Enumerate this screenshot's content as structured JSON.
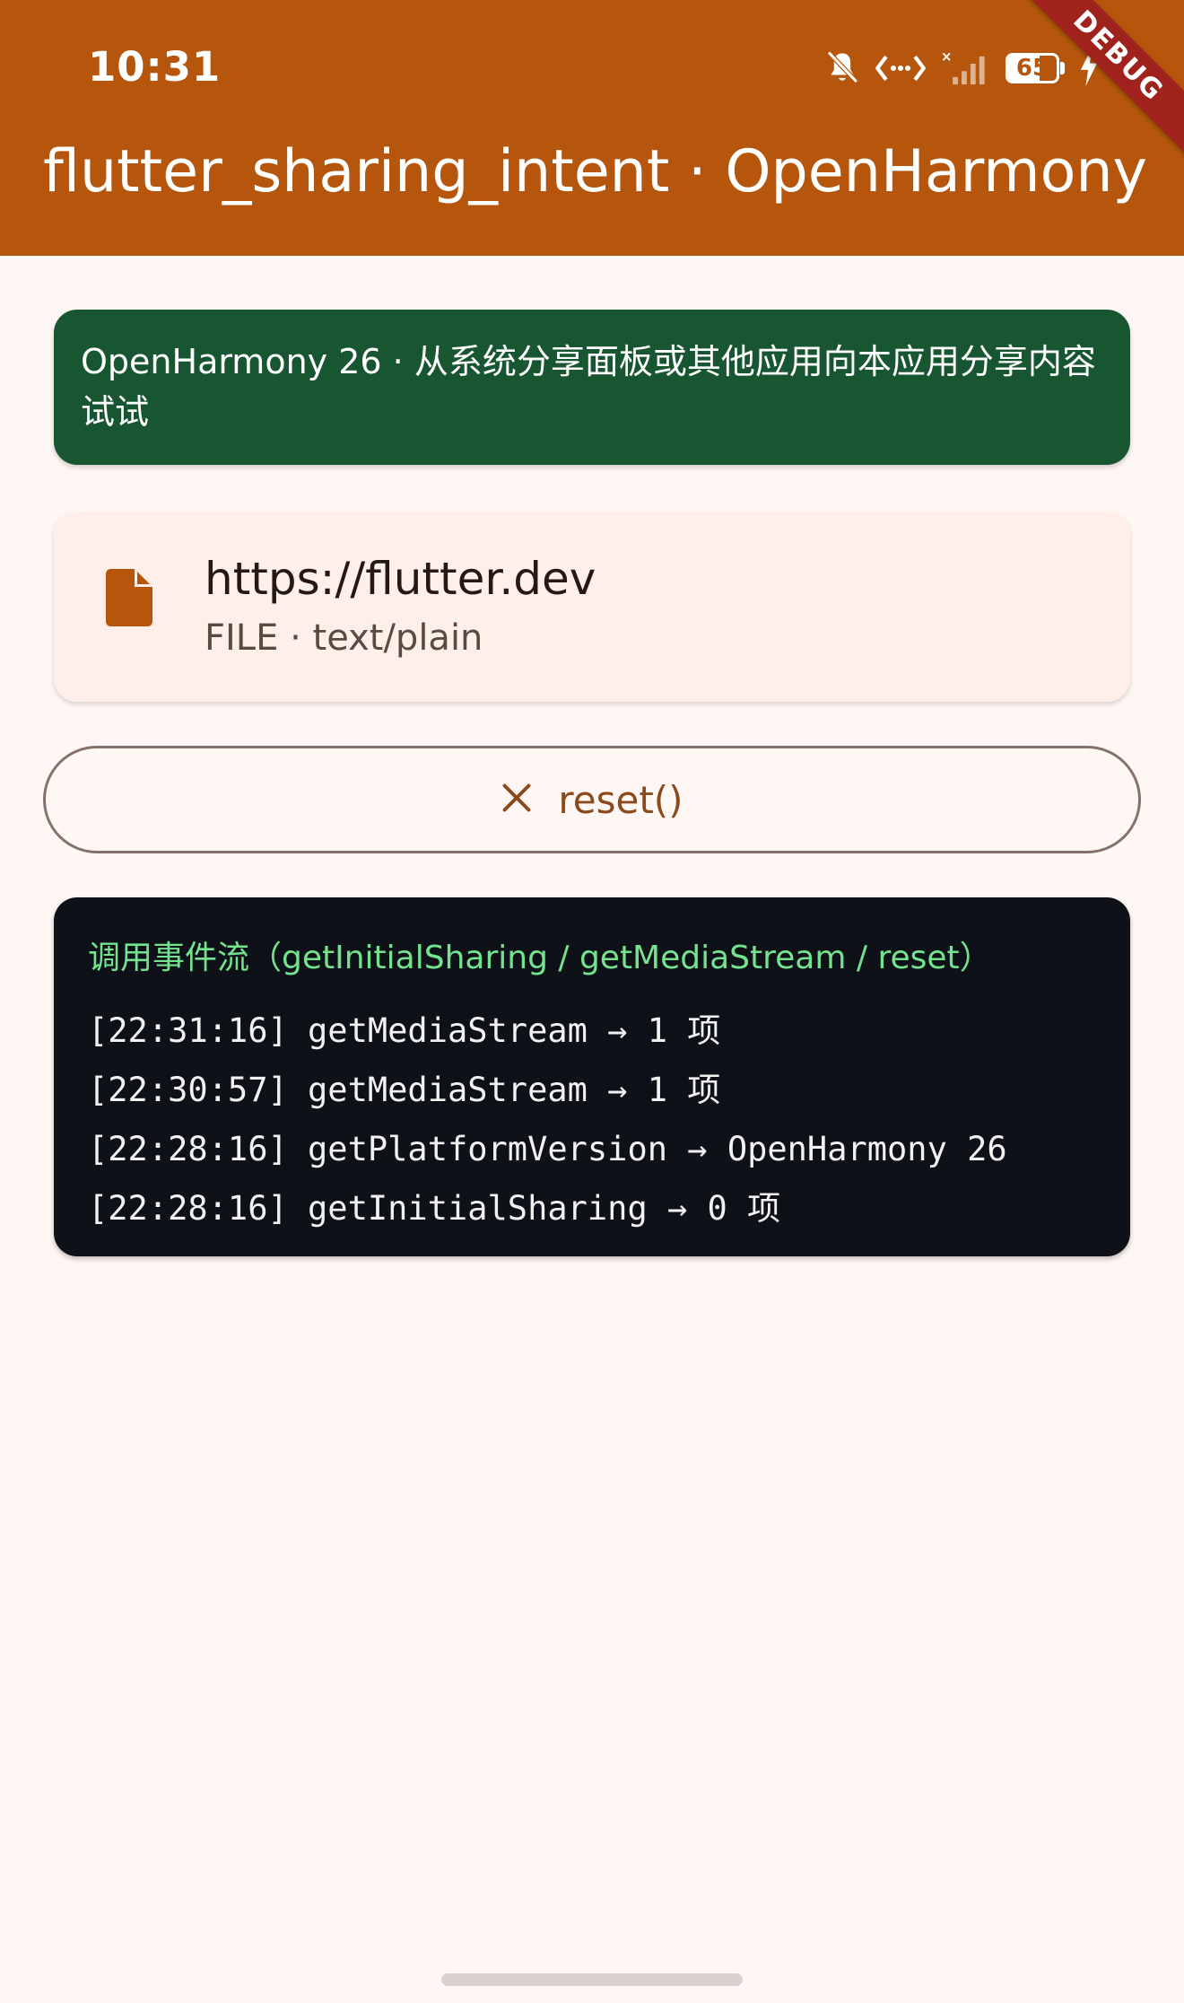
{
  "status_bar": {
    "time": "10:31",
    "battery_level": "65",
    "icons": [
      "bell-off-icon",
      "data-transfer-icon",
      "signal-off-icon",
      "battery-icon",
      "charging-icon"
    ]
  },
  "app_bar": {
    "title": "flutter_sharing_intent · OpenHarmony",
    "background_color": "#B6560C"
  },
  "debug_banner": {
    "label": "DEBUG"
  },
  "info_banner": {
    "text": "OpenHarmony 26 · 从系统分享面板或其他应用向本应用分享内容试试",
    "background_color": "#175630"
  },
  "shared_item": {
    "icon": "file-icon",
    "title": "https://flutter.dev",
    "subtitle": "FILE · text/plain"
  },
  "reset_button": {
    "icon": "close-icon",
    "label": "reset()"
  },
  "event_log": {
    "header": "调用事件流（getInitialSharing / getMediaStream / reset）",
    "lines": [
      "[22:31:16] getMediaStream → 1 项",
      "[22:30:57] getMediaStream → 1 项",
      "[22:28:16] getPlatformVersion → OpenHarmony 26",
      "[22:28:16] getInitialSharing → 0 项"
    ],
    "background_color": "#0E1118",
    "header_color": "#74E38E"
  }
}
